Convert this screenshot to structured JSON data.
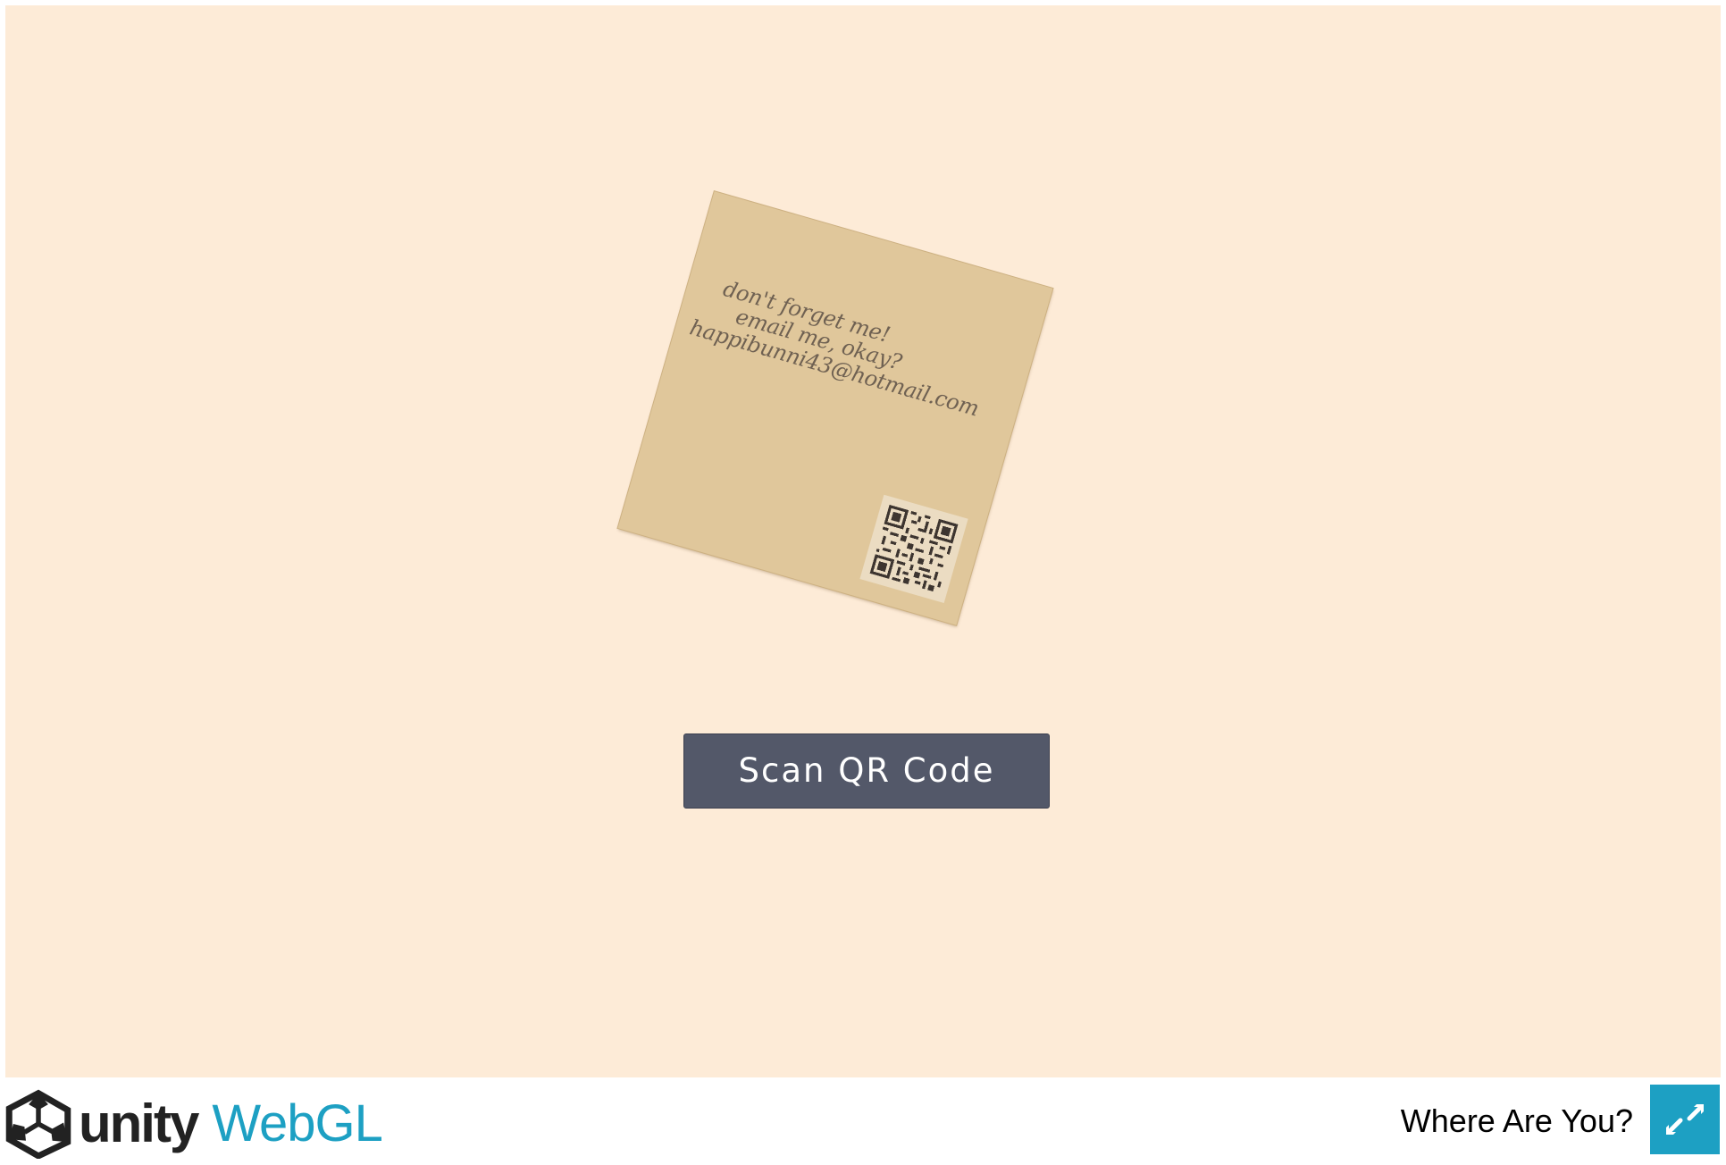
{
  "game": {
    "background_color": "#fdebd7",
    "note": {
      "color": "#e0c79b",
      "lines": [
        "don't forget me!",
        "email me, okay?",
        "happibunni43@hotmail.com"
      ],
      "qr_icon": "qr-code-icon"
    },
    "scan_button_label": "Scan QR Code",
    "scan_button_color": "#535869"
  },
  "footer": {
    "logo_word_unity": "unity",
    "logo_word_webgl": "WebGL",
    "logo_icon": "unity-logo-icon",
    "title": "Where Are You?",
    "fullscreen_icon": "fullscreen-expand-icon",
    "accent_color": "#1da0c3"
  }
}
